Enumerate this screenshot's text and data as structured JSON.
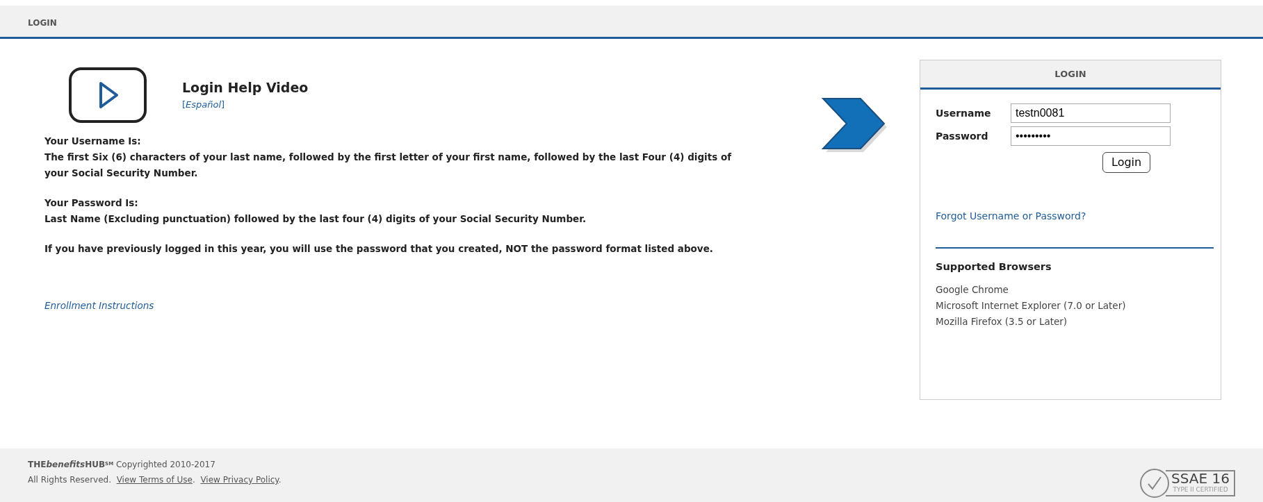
{
  "header": {
    "title": "LOGIN"
  },
  "help": {
    "title": "Login Help Video",
    "language_link": "Español",
    "bracket_open": "[",
    "bracket_close": "]"
  },
  "instructions": [
    {
      "heading": "Your Username Is:",
      "text": "The first Six (6) characters of your last name, followed by the first letter of your first name, followed by the last Four (4) digits of your Social Security Number."
    },
    {
      "heading": "Your Password Is:",
      "text": "Last Name (Excluding punctuation) followed by the last four (4) digits of your Social Security Number."
    },
    {
      "text": "If you have previously logged in this year, you will use the password that you created, NOT the password format listed above."
    }
  ],
  "enrollment_link": "Enrollment Instructions",
  "login_panel": {
    "title": "LOGIN",
    "username": {
      "label": "Username",
      "value": "testn0081"
    },
    "password": {
      "label": "Password",
      "value": "•••••••••"
    },
    "button": "Login",
    "forgot_link": "Forgot Username or Password?",
    "browsers_title": "Supported Browsers",
    "browsers": [
      "Google Chrome",
      "Microsoft Internet Explorer (7.0 or Later)",
      "Mozilla Firefox (3.5 or Later)"
    ]
  },
  "footer": {
    "brand_start": "THE",
    "brand_italic": "benefits",
    "brand_end": "HUB",
    "service_mark": "SM",
    "copyright": "Copyrighted 2010-2017",
    "rights": "All Rights Reserved.",
    "terms_link": "View Terms of Use",
    "separator": ".",
    "privacy_link": "View Privacy Policy",
    "end": "."
  },
  "badge": {
    "title": "SSAE 16",
    "subtitle": "TYPE II CERTIFIED"
  }
}
